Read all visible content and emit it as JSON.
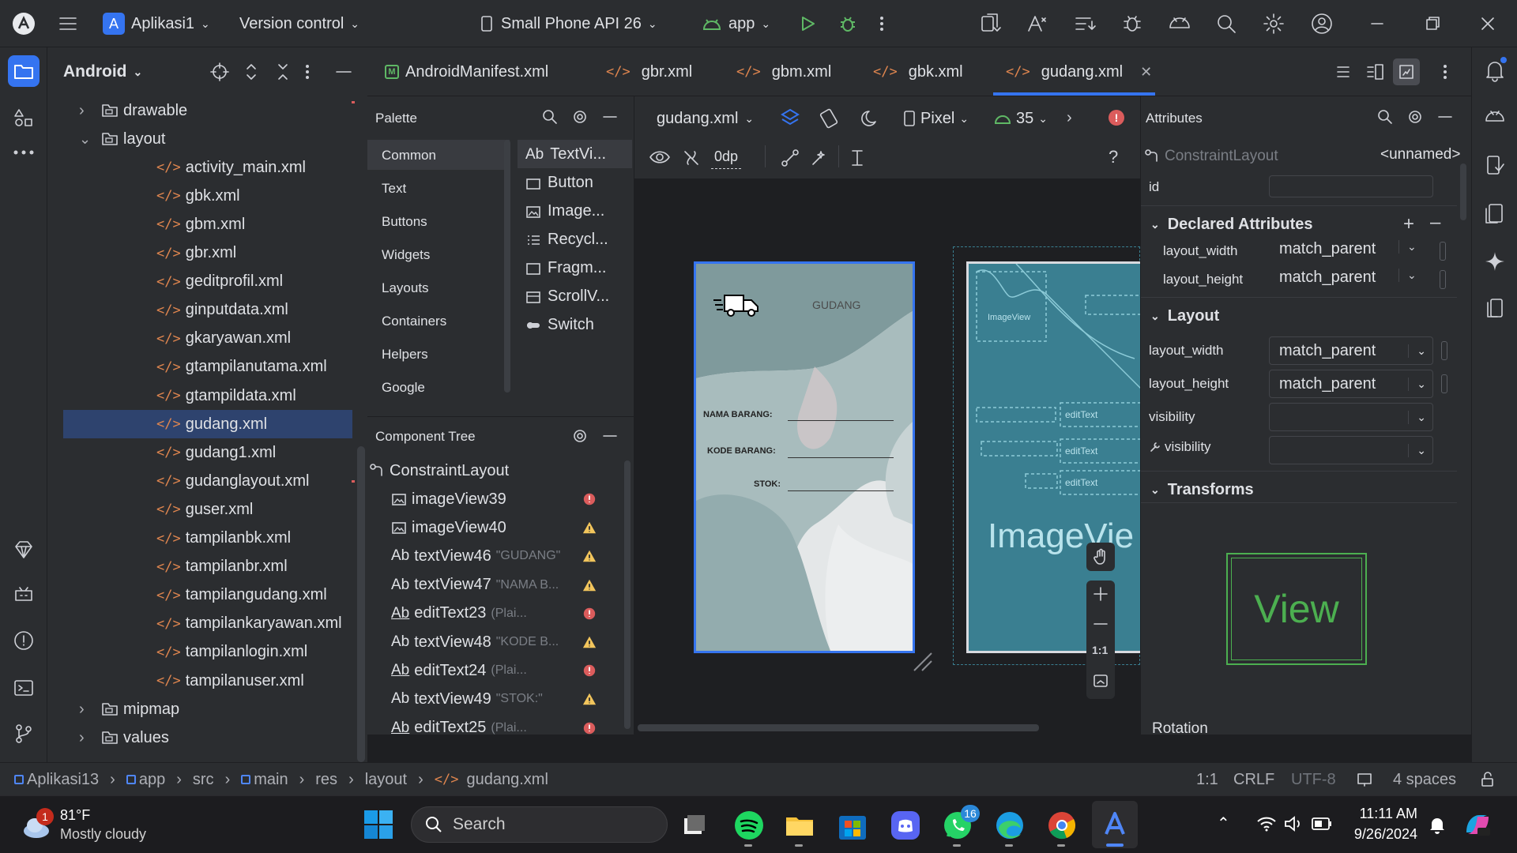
{
  "titlebar": {
    "project_initial": "A",
    "project_name": "Aplikasi1",
    "vcs": "Version control",
    "device": "Small Phone API 26",
    "run_config": "app"
  },
  "project_panel": {
    "view": "Android",
    "tree": [
      {
        "label": "drawable",
        "type": "folder",
        "depth": 1,
        "expanded": false
      },
      {
        "label": "layout",
        "type": "folder",
        "depth": 1,
        "expanded": true
      },
      {
        "label": "activity_main.xml",
        "type": "xml",
        "depth": 2
      },
      {
        "label": "gbk.xml",
        "type": "xml",
        "depth": 2
      },
      {
        "label": "gbm.xml",
        "type": "xml",
        "depth": 2
      },
      {
        "label": "gbr.xml",
        "type": "xml",
        "depth": 2
      },
      {
        "label": "geditprofil.xml",
        "type": "xml",
        "depth": 2
      },
      {
        "label": "ginputdata.xml",
        "type": "xml",
        "depth": 2
      },
      {
        "label": "gkaryawan.xml",
        "type": "xml",
        "depth": 2
      },
      {
        "label": "gtampilanutama.xml",
        "type": "xml",
        "depth": 2
      },
      {
        "label": "gtampildata.xml",
        "type": "xml",
        "depth": 2
      },
      {
        "label": "gudang.xml",
        "type": "xml",
        "depth": 2,
        "selected": true
      },
      {
        "label": "gudang1.xml",
        "type": "xml",
        "depth": 2
      },
      {
        "label": "gudanglayout.xml",
        "type": "xml",
        "depth": 2
      },
      {
        "label": "guser.xml",
        "type": "xml",
        "depth": 2
      },
      {
        "label": "tampilanbk.xml",
        "type": "xml",
        "depth": 2
      },
      {
        "label": "tampilanbr.xml",
        "type": "xml",
        "depth": 2
      },
      {
        "label": "tampilangudang.xml",
        "type": "xml",
        "depth": 2
      },
      {
        "label": "tampilankaryawan.xml",
        "type": "xml",
        "depth": 2
      },
      {
        "label": "tampilanlogin.xml",
        "type": "xml",
        "depth": 2
      },
      {
        "label": "tampilanuser.xml",
        "type": "xml",
        "depth": 2
      },
      {
        "label": "mipmap",
        "type": "folder",
        "depth": 1,
        "expanded": false
      },
      {
        "label": "values",
        "type": "folder",
        "depth": 1,
        "expanded": false
      }
    ]
  },
  "tabs": [
    {
      "label": "AndroidManifest.xml",
      "icon": "manifest-icon"
    },
    {
      "label": "gbr.xml",
      "icon": "xml-icon"
    },
    {
      "label": "gbm.xml",
      "icon": "xml-icon"
    },
    {
      "label": "gbk.xml",
      "icon": "xml-icon"
    },
    {
      "label": "gudang.xml",
      "icon": "xml-icon",
      "active": true
    }
  ],
  "palette": {
    "title": "Palette",
    "categories": [
      "Common",
      "Text",
      "Buttons",
      "Widgets",
      "Layouts",
      "Containers",
      "Helpers",
      "Google"
    ],
    "items": [
      {
        "label": "TextVi...",
        "icon": "Ab"
      },
      {
        "label": "Button",
        "icon": "button-icon"
      },
      {
        "label": "Image...",
        "icon": "image-icon"
      },
      {
        "label": "Recycl...",
        "icon": "list-icon"
      },
      {
        "label": "Fragm...",
        "icon": "fragment-icon"
      },
      {
        "label": "ScrollV...",
        "icon": "scroll-icon"
      },
      {
        "label": "Switch",
        "icon": "switch-icon"
      }
    ]
  },
  "component_tree": {
    "title": "Component Tree",
    "root": "ConstraintLayout",
    "items": [
      {
        "label": "imageView39",
        "hint": "",
        "kind": "image",
        "status": "error"
      },
      {
        "label": "imageView40",
        "hint": "",
        "kind": "image",
        "status": "warning"
      },
      {
        "label": "textView46",
        "hint": "\"GUDANG\"",
        "kind": "text",
        "status": "warning"
      },
      {
        "label": "textView47",
        "hint": "\"NAMA B...",
        "kind": "text",
        "status": "warning"
      },
      {
        "label": "editText23",
        "hint": "(Plai...",
        "kind": "edit",
        "status": "error"
      },
      {
        "label": "textView48",
        "hint": "\"KODE B...",
        "kind": "text",
        "status": "warning"
      },
      {
        "label": "editText24",
        "hint": "(Plai...",
        "kind": "edit",
        "status": "error"
      },
      {
        "label": "textView49",
        "hint": "\"STOK:\"",
        "kind": "text",
        "status": "warning"
      },
      {
        "label": "editText25",
        "hint": "(Plai...",
        "kind": "edit",
        "status": "error"
      }
    ]
  },
  "design_toolbar": {
    "file": "gudang.xml",
    "device": "Pixel",
    "api": "35",
    "margin": "0dp"
  },
  "preview": {
    "title": "GUDANG",
    "labels": [
      "NAMA BARANG:",
      "KODE BARANG:",
      "STOK:"
    ],
    "blueprint_image_label": "ImageView",
    "blueprint_big_label": "ImageVie",
    "blueprint_edit_label": "editText",
    "zoom_fit": "1:1"
  },
  "attributes": {
    "title": "Attributes",
    "component": "ConstraintLayout",
    "component_name": "<unnamed>",
    "id_label": "id",
    "declared_title": "Declared Attributes",
    "declared": [
      {
        "name": "layout_width",
        "value": "match_parent"
      },
      {
        "name": "layout_height",
        "value": "match_parent"
      }
    ],
    "layout_title": "Layout",
    "layout": [
      {
        "name": "layout_width",
        "value": "match_parent"
      },
      {
        "name": "layout_height",
        "value": "match_parent"
      },
      {
        "name": "visibility",
        "value": ""
      },
      {
        "name": "visibility",
        "value": ""
      }
    ],
    "transforms_title": "Transforms",
    "view_preview": "View",
    "rotation_label": "Rotation"
  },
  "statusbar": {
    "breadcrumb": [
      "Aplikasi13",
      "app",
      "src",
      "main",
      "res",
      "layout",
      "gudang.xml"
    ],
    "position": "1:1",
    "line_sep": "CRLF",
    "encoding": "UTF-8",
    "indent": "4 spaces"
  },
  "taskbar": {
    "weather_temp": "81°F",
    "weather_desc": "Mostly cloudy",
    "weather_badge": "1",
    "search": "Search",
    "whatsapp_badge": "16",
    "time": "11:11 AM",
    "date": "9/26/2024"
  },
  "colors": {
    "accent": "#3574f0",
    "error": "#db5c5c",
    "warning": "#f2c55c",
    "xml": "#e0864f",
    "selection": "#2e436e",
    "blueprint": "#3a7f91"
  }
}
